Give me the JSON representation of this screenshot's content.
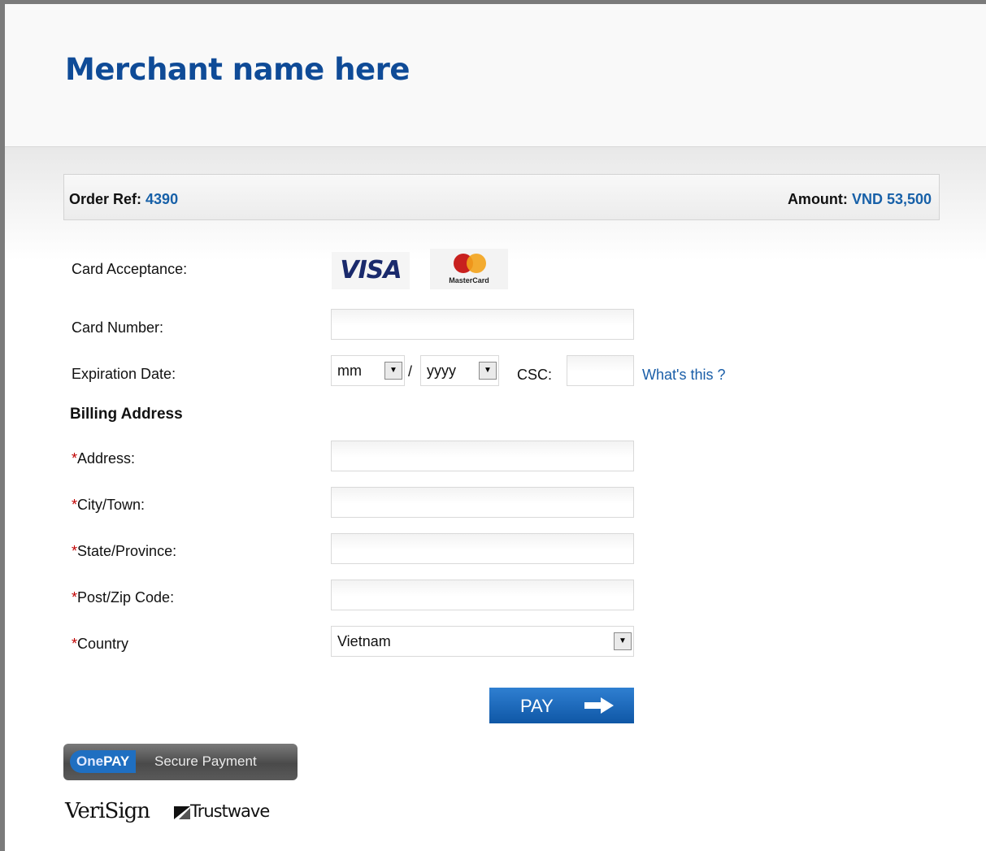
{
  "header": {
    "merchant_name": "Merchant name here"
  },
  "order": {
    "ref_label": "Order Ref:",
    "ref_value": "4390",
    "amount_label": "Amount:",
    "amount_value": "VND 53,500"
  },
  "form": {
    "card_acceptance_label": "Card Acceptance:",
    "card_brands": [
      "VISA",
      "MasterCard"
    ],
    "card_number_label": "Card Number:",
    "card_number_value": "",
    "expiration_label": "Expiration Date:",
    "month_value": "mm",
    "year_value": "yyyy",
    "date_separator": "/",
    "csc_label": "CSC:",
    "csc_value": "",
    "csc_help_link": "What's this ?",
    "billing_heading": "Billing Address",
    "required_mark": "*",
    "address_label": "Address:",
    "address_value": "",
    "city_label": "City/Town:",
    "city_value": "",
    "state_label": "State/Province:",
    "state_value": "",
    "zip_label": "Post/Zip Code:",
    "zip_value": "",
    "country_label": "Country",
    "country_value": "Vietnam",
    "pay_label": "PAY"
  },
  "footer": {
    "onepay_one": "One",
    "onepay_pay": "PAY",
    "onepay_tagline": "Secure Payment",
    "verisign": "VeriSign",
    "trustwave": "Trustwave"
  },
  "colors": {
    "brand_blue": "#0f4b97",
    "link_blue": "#1a5ea8",
    "required_red": "#c00000",
    "pay_button": "#1f68b8"
  },
  "icons": [
    "dropdown-arrow-icon",
    "arrow-right-icon",
    "trustwave-logo-icon"
  ]
}
